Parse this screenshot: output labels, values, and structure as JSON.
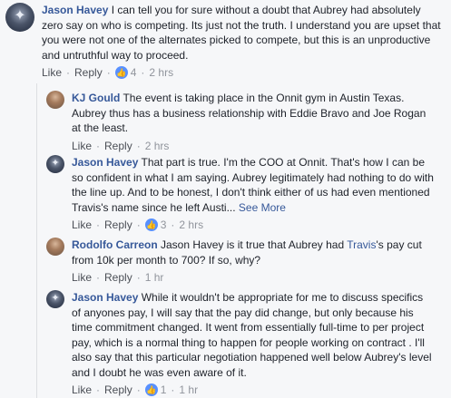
{
  "colors": {
    "name": "#365899",
    "meta": "#90949c",
    "react": "#5890ff",
    "background": "#f6f7f9"
  },
  "comments": [
    {
      "author": "Jason Havey",
      "text": " I can tell you for sure without a doubt that Aubrey had absolutely zero say on who is competing. Its just not the truth. I understand you are upset that you were not one of the alternates picked to compete, but this is an unproductive and untruthful way to proceed.",
      "like": "Like",
      "reply": "Reply",
      "reactions": "4",
      "time": "2 hrs",
      "avatar_icon": "star-avatar-icon"
    },
    {
      "author": "KJ Gould",
      "text": " The event is taking place in the Onnit gym in Austin Texas. Aubrey thus has a business relationship with Eddie Bravo and Joe Rogan at the least.",
      "like": "Like",
      "reply": "Reply",
      "time": "2 hrs",
      "avatar_icon": "photo-avatar-icon"
    },
    {
      "author": "Jason Havey",
      "text": " That part is true. I'm the COO at Onnit. That's how I can be so confident in what I am saying. Aubrey legitimately had nothing to do with the line up. And to be honest, I don't think either of us had even mentioned Travis's name since he left Austi...",
      "see_more": " See More",
      "like": "Like",
      "reply": "Reply",
      "reactions": "3",
      "time": "2 hrs",
      "avatar_icon": "star-avatar-icon"
    },
    {
      "author": "Rodolfo Carreon",
      "text_pre": " Jason Havey is it true that Aubrey had ",
      "mention": "Travis",
      "text_post": "'s pay cut from 10k per month to 700? If so, why?",
      "like": "Like",
      "reply": "Reply",
      "time": "1 hr",
      "avatar_icon": "photo-avatar-icon"
    },
    {
      "author": "Jason Havey",
      "text": " While it wouldn't be appropriate for me to discuss specifics of anyones pay, I will say that the pay did change, but only because his time commitment changed. It went from essentially full-time to per project pay, which is a normal thing to happen for people working on contract . I'll also say that this particular negotiation happened well below Aubrey's level and I doubt he was even aware of it.",
      "like": "Like",
      "reply": "Reply",
      "reactions": "1",
      "time": "1 hr",
      "avatar_icon": "star-avatar-icon"
    }
  ]
}
